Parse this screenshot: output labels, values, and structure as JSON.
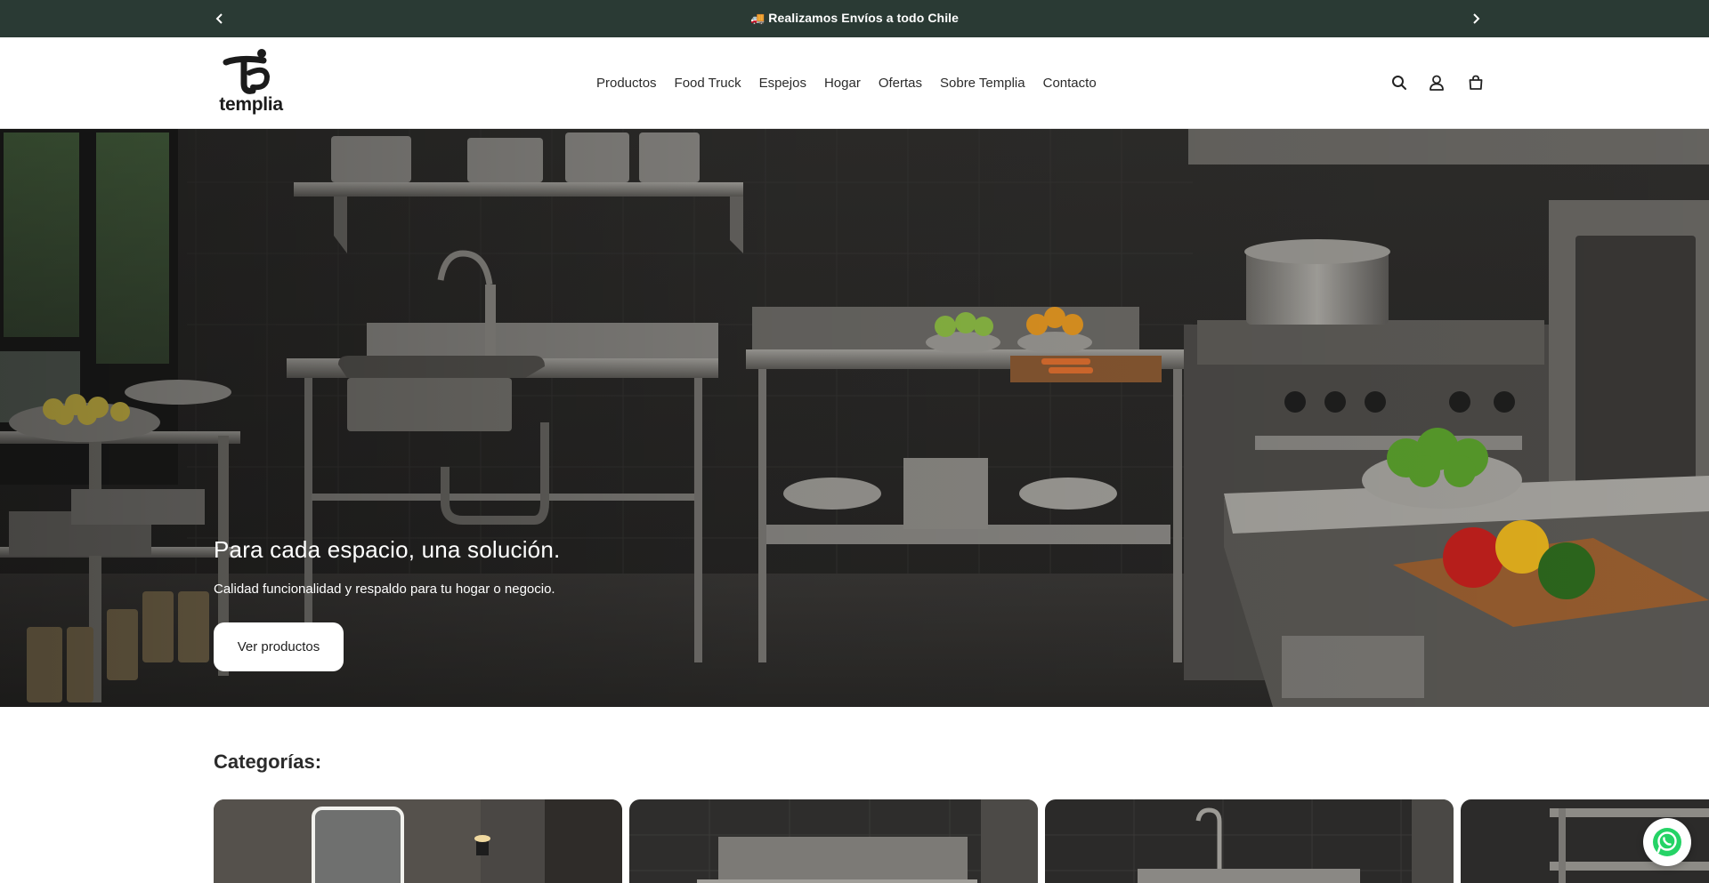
{
  "announcement": {
    "message": "Realizamos Envíos a todo Chile",
    "truck_emoji": "🚚"
  },
  "header": {
    "logo_text": "templia",
    "nav": [
      {
        "label": "Productos"
      },
      {
        "label": "Food Truck"
      },
      {
        "label": "Espejos"
      },
      {
        "label": "Hogar"
      },
      {
        "label": "Ofertas"
      },
      {
        "label": "Sobre Templia"
      },
      {
        "label": "Contacto"
      }
    ],
    "icons": [
      "search-icon",
      "account-icon",
      "cart-icon"
    ]
  },
  "hero": {
    "title": "Para cada espacio, una solución.",
    "subtitle": "Calidad funcionalidad y respaldo para tu hogar o negocio.",
    "button_label": "Ver productos"
  },
  "categories": {
    "title": "Categorías:",
    "card_images": [
      "mirror-bathroom",
      "steel-worktable",
      "steel-sink",
      "steel-shelving"
    ]
  },
  "colors": {
    "announcement_bg": "#2a3a34",
    "whatsapp_green": "#25d366"
  }
}
